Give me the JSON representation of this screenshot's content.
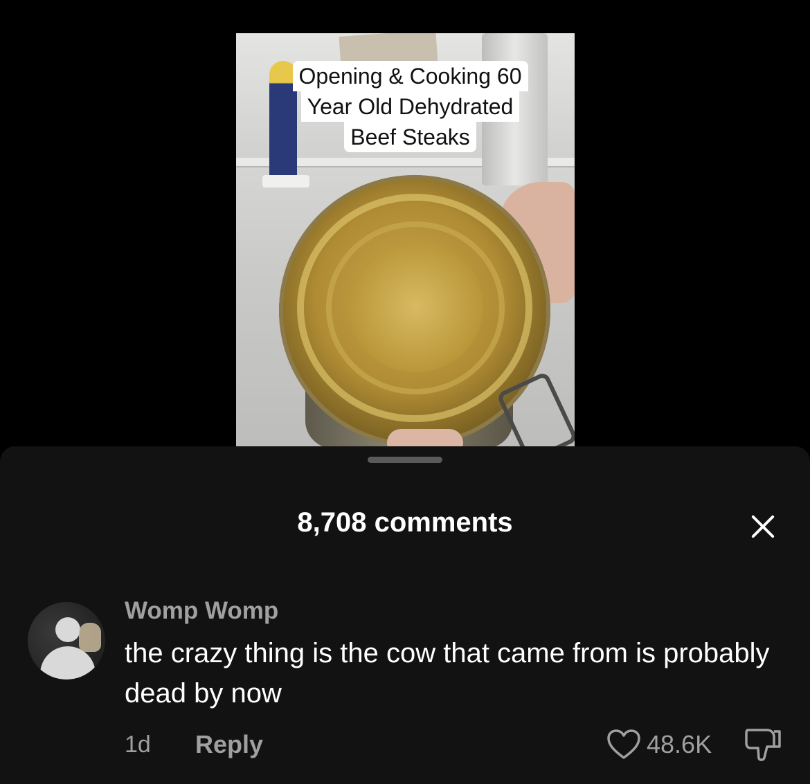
{
  "video": {
    "caption_lines": [
      "Opening & Cooking 60",
      "Year Old Dehydrated",
      "Beef Steaks"
    ]
  },
  "comments_panel": {
    "title": "8,708 comments",
    "comment": {
      "username": "Womp Womp",
      "text": "the crazy thing is the cow that came from is probably dead by now",
      "time": "1d",
      "reply_label": "Reply",
      "like_count": "48.6K"
    }
  },
  "icons": [
    "close-icon",
    "heart-icon",
    "dislike-icon"
  ],
  "colors": {
    "background": "#000000",
    "sheet": "#121212",
    "muted_text": "#a0a0a0"
  }
}
